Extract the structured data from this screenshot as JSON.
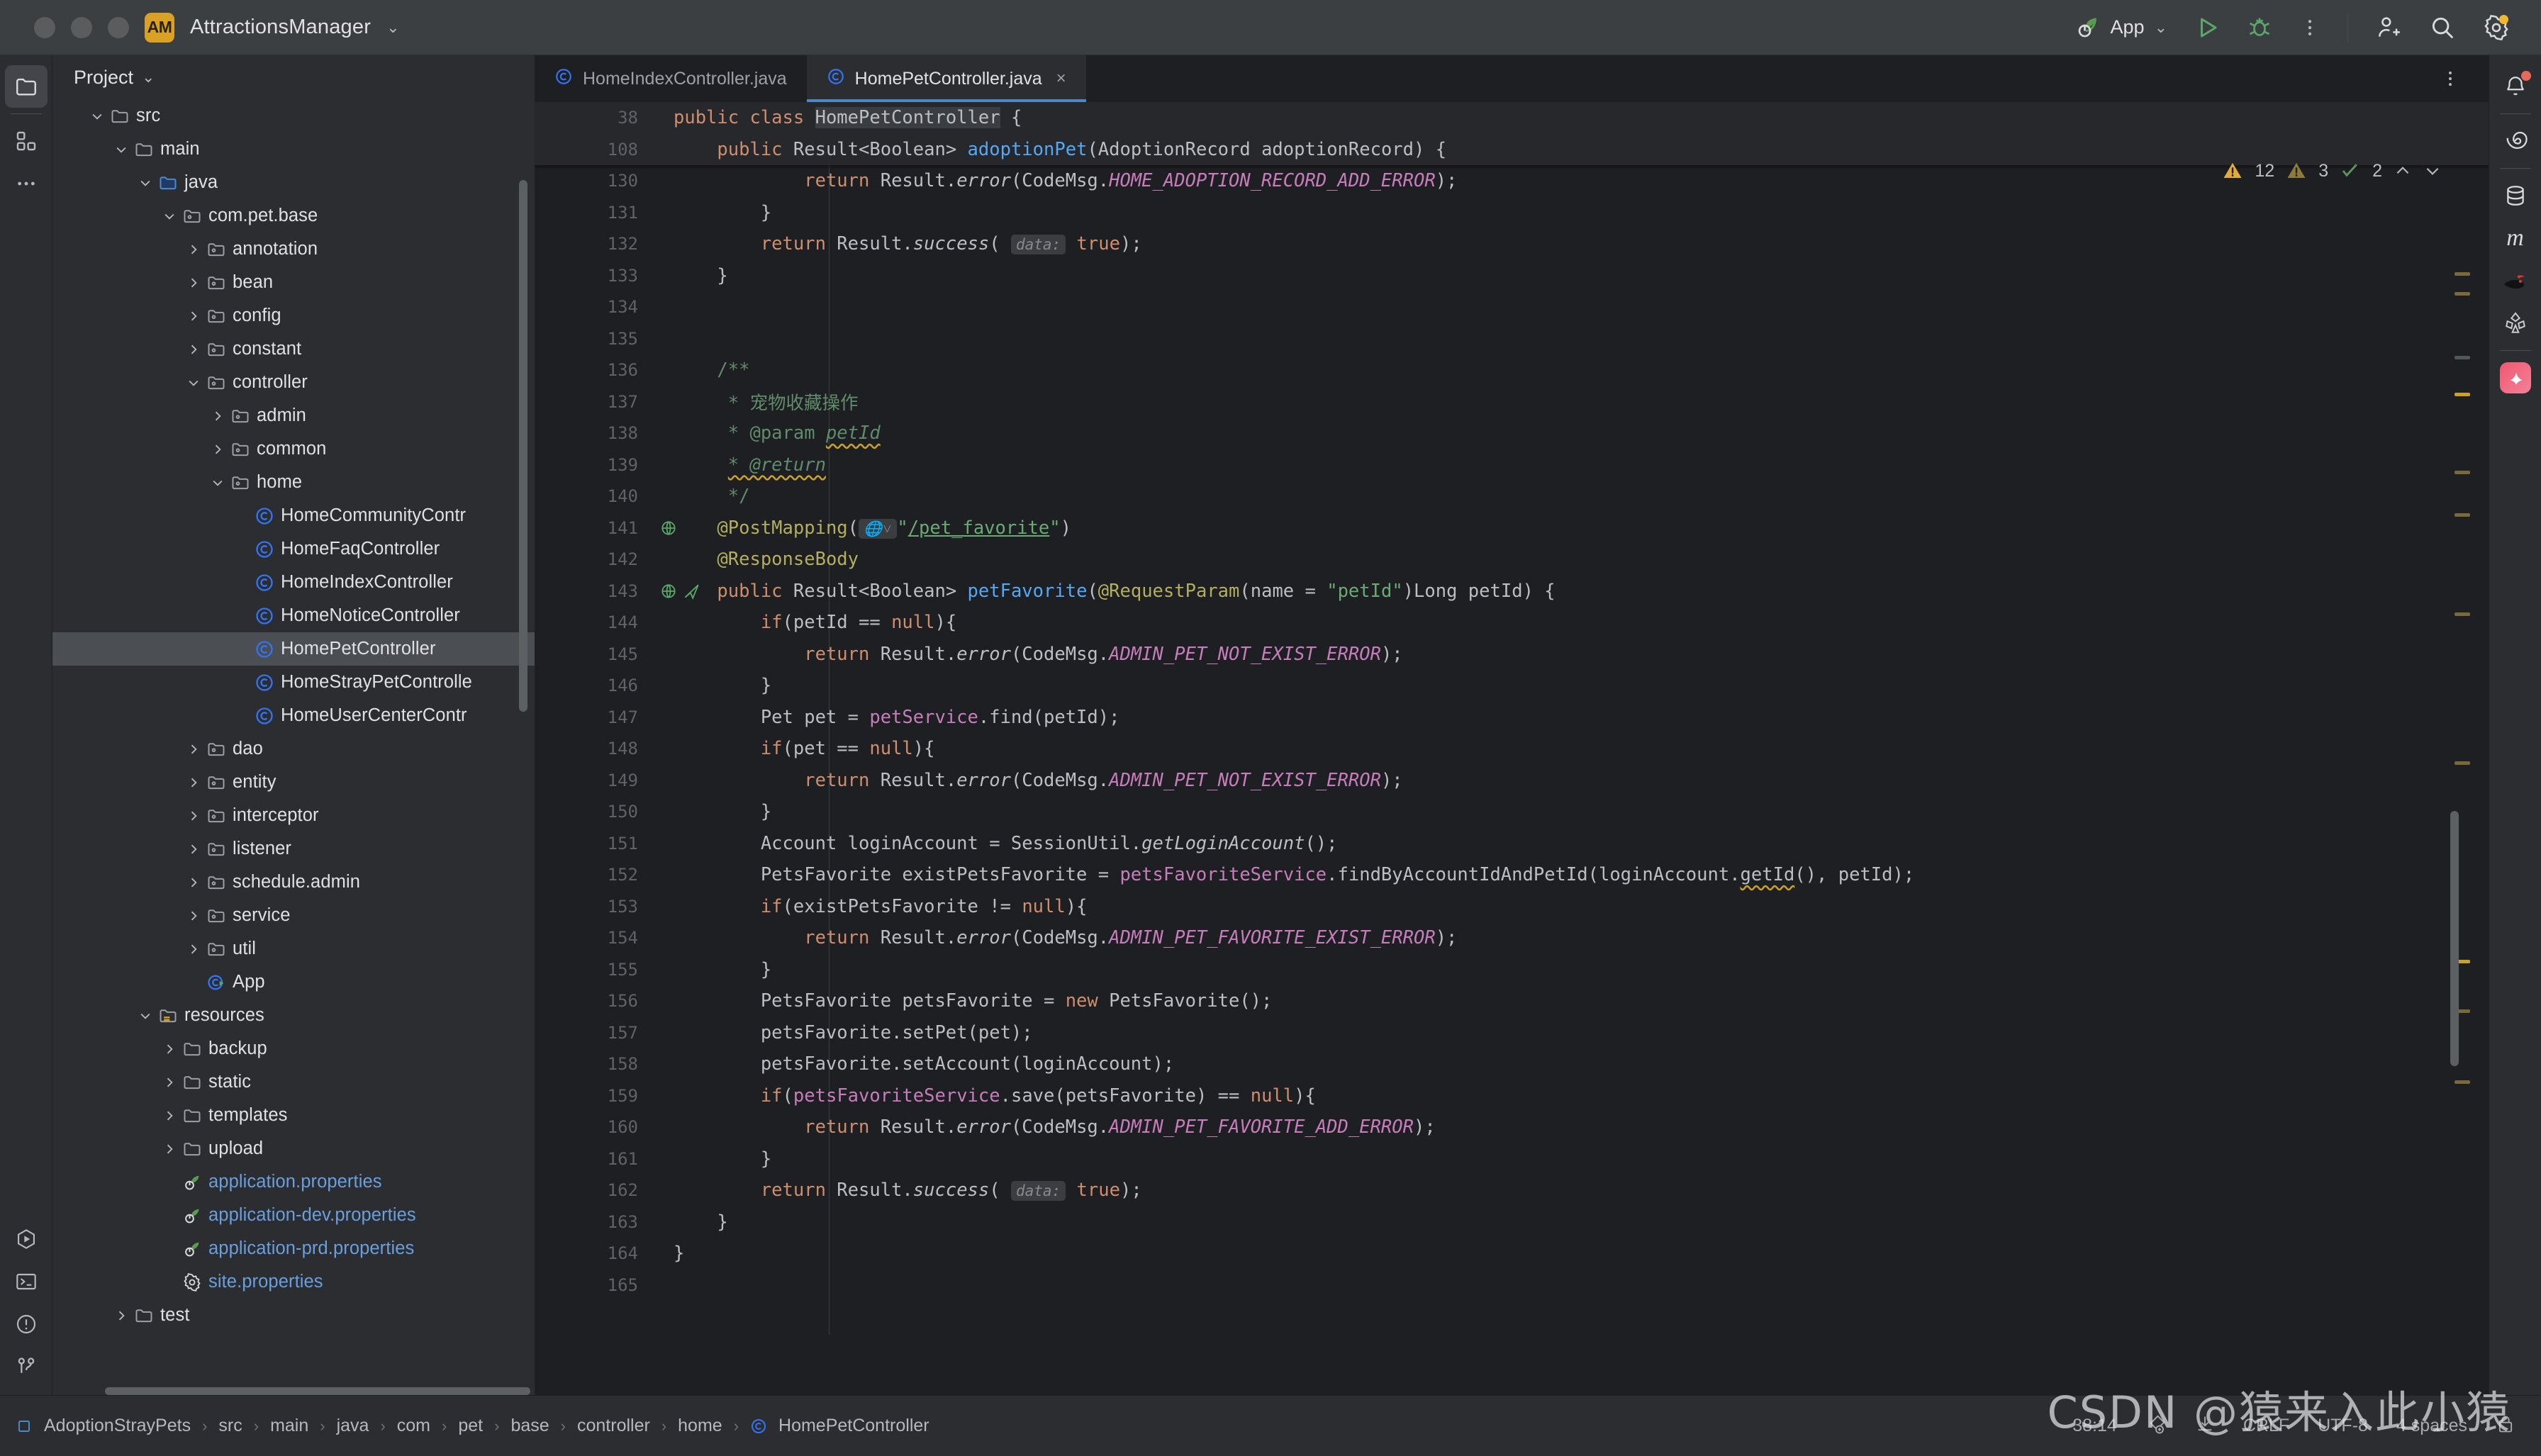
{
  "titlebar": {
    "project_badge": "AM",
    "project_name": "AttractionsManager",
    "run_config": "App",
    "icons": [
      "spring-leaf-icon",
      "run-icon",
      "debug-icon",
      "more-vertical-icon",
      "add-user-icon",
      "search-icon",
      "settings-icon"
    ]
  },
  "left_rail": {
    "items": [
      "project-icon",
      "structure-icon",
      "more-icon",
      "run-icon",
      "terminal-icon",
      "problems-icon",
      "version-control-icon"
    ]
  },
  "right_rail": {
    "items": [
      "notifications-icon",
      "spiral-icon",
      "database-icon",
      "maven-icon",
      "mybatisx-icon",
      "gradle-icon",
      "app-icon"
    ]
  },
  "project_panel": {
    "title": "Project",
    "tree": [
      {
        "label": "src",
        "indent": 1,
        "arrow": "down",
        "icon": "folder"
      },
      {
        "label": "main",
        "indent": 2,
        "arrow": "down",
        "icon": "folder"
      },
      {
        "label": "java",
        "indent": 3,
        "arrow": "down",
        "icon": "source-folder"
      },
      {
        "label": "com.pet.base",
        "indent": 4,
        "arrow": "down",
        "icon": "package"
      },
      {
        "label": "annotation",
        "indent": 5,
        "arrow": "right",
        "icon": "package"
      },
      {
        "label": "bean",
        "indent": 5,
        "arrow": "right",
        "icon": "package"
      },
      {
        "label": "config",
        "indent": 5,
        "arrow": "right",
        "icon": "package"
      },
      {
        "label": "constant",
        "indent": 5,
        "arrow": "right",
        "icon": "package"
      },
      {
        "label": "controller",
        "indent": 5,
        "arrow": "down",
        "icon": "package"
      },
      {
        "label": "admin",
        "indent": 6,
        "arrow": "right",
        "icon": "package"
      },
      {
        "label": "common",
        "indent": 6,
        "arrow": "right",
        "icon": "package"
      },
      {
        "label": "home",
        "indent": 6,
        "arrow": "down",
        "icon": "package"
      },
      {
        "label": "HomeCommunityContr",
        "indent": 7,
        "arrow": "none",
        "icon": "class"
      },
      {
        "label": "HomeFaqController",
        "indent": 7,
        "arrow": "none",
        "icon": "class"
      },
      {
        "label": "HomeIndexController",
        "indent": 7,
        "arrow": "none",
        "icon": "class"
      },
      {
        "label": "HomeNoticeController",
        "indent": 7,
        "arrow": "none",
        "icon": "class"
      },
      {
        "label": "HomePetController",
        "indent": 7,
        "arrow": "none",
        "icon": "class",
        "selected": true
      },
      {
        "label": "HomeStrayPetControlle",
        "indent": 7,
        "arrow": "none",
        "icon": "class"
      },
      {
        "label": "HomeUserCenterContr",
        "indent": 7,
        "arrow": "none",
        "icon": "class"
      },
      {
        "label": "dao",
        "indent": 5,
        "arrow": "right",
        "icon": "package"
      },
      {
        "label": "entity",
        "indent": 5,
        "arrow": "right",
        "icon": "package"
      },
      {
        "label": "interceptor",
        "indent": 5,
        "arrow": "right",
        "icon": "package"
      },
      {
        "label": "listener",
        "indent": 5,
        "arrow": "right",
        "icon": "package"
      },
      {
        "label": "schedule.admin",
        "indent": 5,
        "arrow": "right",
        "icon": "package"
      },
      {
        "label": "service",
        "indent": 5,
        "arrow": "right",
        "icon": "package"
      },
      {
        "label": "util",
        "indent": 5,
        "arrow": "right",
        "icon": "package"
      },
      {
        "label": "App",
        "indent": 5,
        "arrow": "none",
        "icon": "spring-class"
      },
      {
        "label": "resources",
        "indent": 3,
        "arrow": "down",
        "icon": "resource-folder"
      },
      {
        "label": "backup",
        "indent": 4,
        "arrow": "right",
        "icon": "folder"
      },
      {
        "label": "static",
        "indent": 4,
        "arrow": "right",
        "icon": "folder"
      },
      {
        "label": "templates",
        "indent": 4,
        "arrow": "right",
        "icon": "folder"
      },
      {
        "label": "upload",
        "indent": 4,
        "arrow": "right",
        "icon": "folder"
      },
      {
        "label": "application.properties",
        "indent": 4,
        "arrow": "none",
        "icon": "spring-properties",
        "blue": true
      },
      {
        "label": "application-dev.properties",
        "indent": 4,
        "arrow": "none",
        "icon": "spring-properties",
        "blue": true
      },
      {
        "label": "application-prd.properties",
        "indent": 4,
        "arrow": "none",
        "icon": "spring-properties",
        "blue": true
      },
      {
        "label": "site.properties",
        "indent": 4,
        "arrow": "none",
        "icon": "gear-properties",
        "blue": true
      },
      {
        "label": "test",
        "indent": 2,
        "arrow": "right",
        "icon": "folder"
      }
    ]
  },
  "editor": {
    "tabs": [
      {
        "label": "HomeIndexController.java",
        "icon": "class-icon",
        "active": false
      },
      {
        "label": "HomePetController.java",
        "icon": "class-icon",
        "active": true,
        "closable": true
      }
    ],
    "inspections": {
      "warnings": "12",
      "weak_warnings": "3",
      "checks": "2"
    },
    "sticky_lines": [
      {
        "num": "38",
        "html": "<span class=\"kw\">public class</span> <span class=\"ident-hl\">HomePetController</span> {"
      },
      {
        "num": "108",
        "html": "    <span class=\"kw\">public</span> Result&lt;Boolean&gt; <span class=\"fn\">adoptionPet</span>(AdoptionRecord adoptionRecord) {"
      }
    ],
    "partial_line": {
      "num": "130",
      "html": "            <span class=\"kw\">return</span> Result.<span class=\"stat\">error</span>(CodeMsg.<span class=\"const\">HOME_ADOPTION_RECORD_ADD_ERROR</span>);"
    },
    "lines": [
      {
        "num": "131",
        "html": "        }"
      },
      {
        "num": "132",
        "html": "        <span class=\"kw\">return</span> Result.<span class=\"stat\">success</span>( <span class=\"hint\">data:</span> <span class=\"kw\">true</span>);"
      },
      {
        "num": "133",
        "html": "    }"
      },
      {
        "num": "134",
        "html": ""
      },
      {
        "num": "135",
        "html": ""
      },
      {
        "num": "136",
        "html": "    <span class=\"doc\">/**</span>"
      },
      {
        "num": "137",
        "html": "     <span class=\"doc\">* 宠物收藏操作</span>"
      },
      {
        "num": "138",
        "html": "     <span class=\"doc\">* @param </span><span class=\"doc sq-warn\"><i>petId</i></span>"
      },
      {
        "num": "139",
        "html": "     <span class=\"doc sq-warn\"><i>* @return</i></span>"
      },
      {
        "num": "140",
        "html": "     <span class=\"doc\">*/</span>"
      },
      {
        "num": "141",
        "html": "    <span class=\"anno\">@PostMapping</span>(<span class=\"hint\">&#127760;&#709;</span><span class=\"str\">\"</span><span class=\"url-link\">/pet_favorite</span><span class=\"str\">\"</span>)",
        "gutter": "web-icon"
      },
      {
        "num": "142",
        "html": "    <span class=\"anno\">@ResponseBody</span>"
      },
      {
        "num": "143",
        "html": "    <span class=\"kw\">public</span> Result&lt;Boolean&gt; <span class=\"fn\">petFavorite</span>(<span class=\"anno\">@RequestParam</span>(name = <span class=\"str\">\"petId\"</span>)Long petId) {",
        "gutter": "mapping-icons"
      },
      {
        "num": "144",
        "html": "        <span class=\"kw\">if</span>(petId == <span class=\"kw\">null</span>){"
      },
      {
        "num": "145",
        "html": "            <span class=\"kw\">return</span> Result.<span class=\"stat\">error</span>(CodeMsg.<span class=\"const\">ADMIN_PET_NOT_EXIST_ERROR</span>);"
      },
      {
        "num": "146",
        "html": "        }"
      },
      {
        "num": "147",
        "html": "        Pet pet = <span class=\"fld\">petService</span>.find(petId);"
      },
      {
        "num": "148",
        "html": "        <span class=\"kw\">if</span>(pet == <span class=\"kw\">null</span>){"
      },
      {
        "num": "149",
        "html": "            <span class=\"kw\">return</span> Result.<span class=\"stat\">error</span>(CodeMsg.<span class=\"const\">ADMIN_PET_NOT_EXIST_ERROR</span>);"
      },
      {
        "num": "150",
        "html": "        }"
      },
      {
        "num": "151",
        "html": "        Account loginAccount = SessionUtil.<span class=\"stat\">getLoginAccount</span>();"
      },
      {
        "num": "152",
        "html": "        PetsFavorite existPetsFavorite = <span class=\"fld\">petsFavoriteService</span>.findByAccountIdAndPetId(loginAccount.<span class=\"sq-warn\">getId</span>(), petId);"
      },
      {
        "num": "153",
        "html": "        <span class=\"kw\">if</span>(existPetsFavorite != <span class=\"kw\">null</span>){"
      },
      {
        "num": "154",
        "html": "            <span class=\"kw\">return</span> Result.<span class=\"stat\">error</span>(CodeMsg.<span class=\"const\">ADMIN_PET_FAVORITE_EXIST_ERROR</span>);"
      },
      {
        "num": "155",
        "html": "        }"
      },
      {
        "num": "156",
        "html": "        PetsFavorite petsFavorite = <span class=\"kw\">new</span> PetsFavorite();"
      },
      {
        "num": "157",
        "html": "        petsFavorite.setPet(pet);"
      },
      {
        "num": "158",
        "html": "        petsFavorite.setAccount(loginAccount);"
      },
      {
        "num": "159",
        "html": "        <span class=\"kw\">if</span>(<span class=\"fld\">petsFavoriteService</span>.save(petsFavorite) == <span class=\"kw\">null</span>){"
      },
      {
        "num": "160",
        "html": "            <span class=\"kw\">return</span> Result.<span class=\"stat\">error</span>(CodeMsg.<span class=\"const\">ADMIN_PET_FAVORITE_ADD_ERROR</span>);"
      },
      {
        "num": "161",
        "html": "        }"
      },
      {
        "num": "162",
        "html": "        <span class=\"kw\">return</span> Result.<span class=\"stat\">success</span>( <span class=\"hint\">data:</span> <span class=\"kw\">true</span>);"
      },
      {
        "num": "163",
        "html": "    }"
      },
      {
        "num": "164",
        "html": "}"
      },
      {
        "num": "165",
        "html": ""
      }
    ]
  },
  "statusbar": {
    "breadcrumb": [
      "AdoptionStrayPets",
      "src",
      "main",
      "java",
      "com",
      "pet",
      "base",
      "controller",
      "home",
      "HomePetController"
    ],
    "caret": "38:14",
    "line_separator": "CRLF",
    "encoding": "UTF-8",
    "indent": "4 spaces",
    "icons": [
      "git-icon",
      "download-icon",
      "lock-icon"
    ]
  },
  "watermark": "CSDN @猿来入此小猿",
  "colors": {
    "accent_blue": "#4a88c7",
    "badge_orange": "#d9a125",
    "warning_yellow": "#c9a227",
    "spring_green": "#6aab73"
  }
}
